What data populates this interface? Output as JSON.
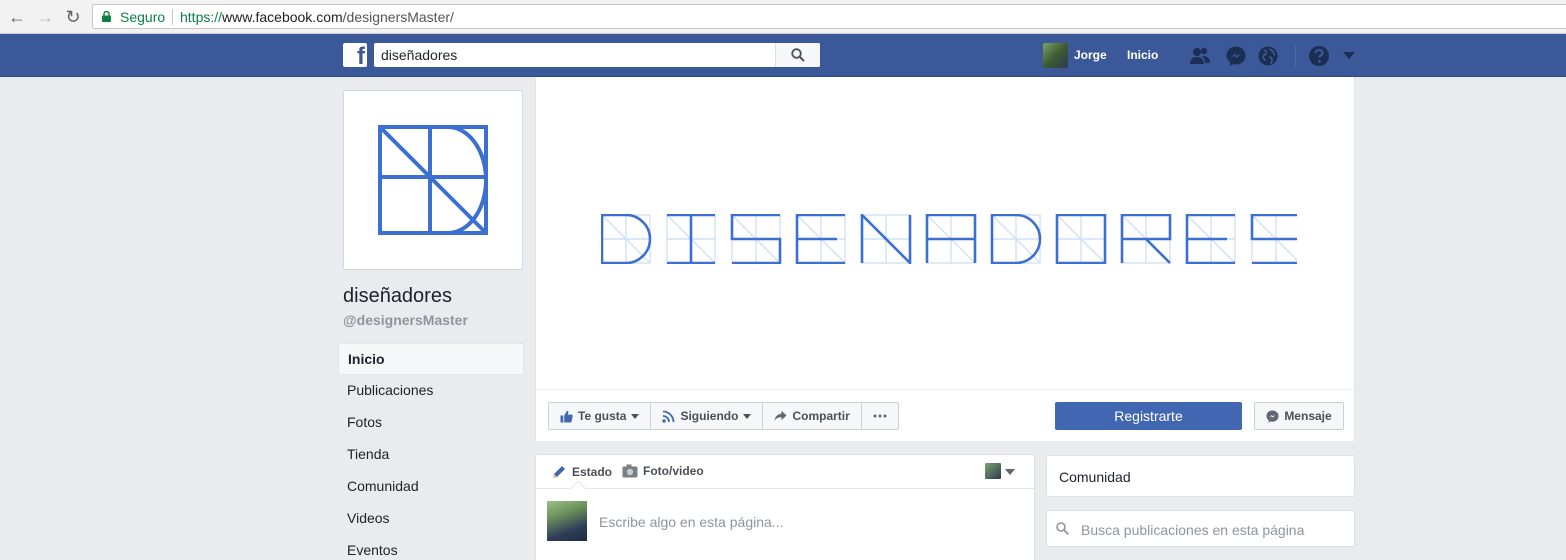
{
  "browser": {
    "secure_label": "Seguro",
    "url_scheme": "https://",
    "url_host": "www.facebook.com",
    "url_path": "/designersMaster/"
  },
  "topbar": {
    "search_value": "diseñadores",
    "user_name": "Jorge",
    "home_label": "Inicio",
    "brand_color": "#3b5998"
  },
  "page": {
    "name": "diseñadores",
    "handle": "@designersMaster",
    "logo_color": "#3b6fd1"
  },
  "left_nav": {
    "items": [
      {
        "label": "Inicio",
        "active": true
      },
      {
        "label": "Publicaciones"
      },
      {
        "label": "Fotos"
      },
      {
        "label": "Tienda"
      },
      {
        "label": "Comunidad"
      },
      {
        "label": "Videos"
      },
      {
        "label": "Eventos"
      }
    ]
  },
  "actions": {
    "like": "Te gusta",
    "follow": "Siguiendo",
    "share": "Compartir",
    "register": "Registrarte",
    "message": "Mensaje"
  },
  "composer": {
    "status_tab": "Estado",
    "photo_tab": "Foto/video",
    "placeholder": "Escribe algo en esta página..."
  },
  "sidebar": {
    "community_title": "Comunidad",
    "search_placeholder": "Busca publicaciones en esta página"
  }
}
